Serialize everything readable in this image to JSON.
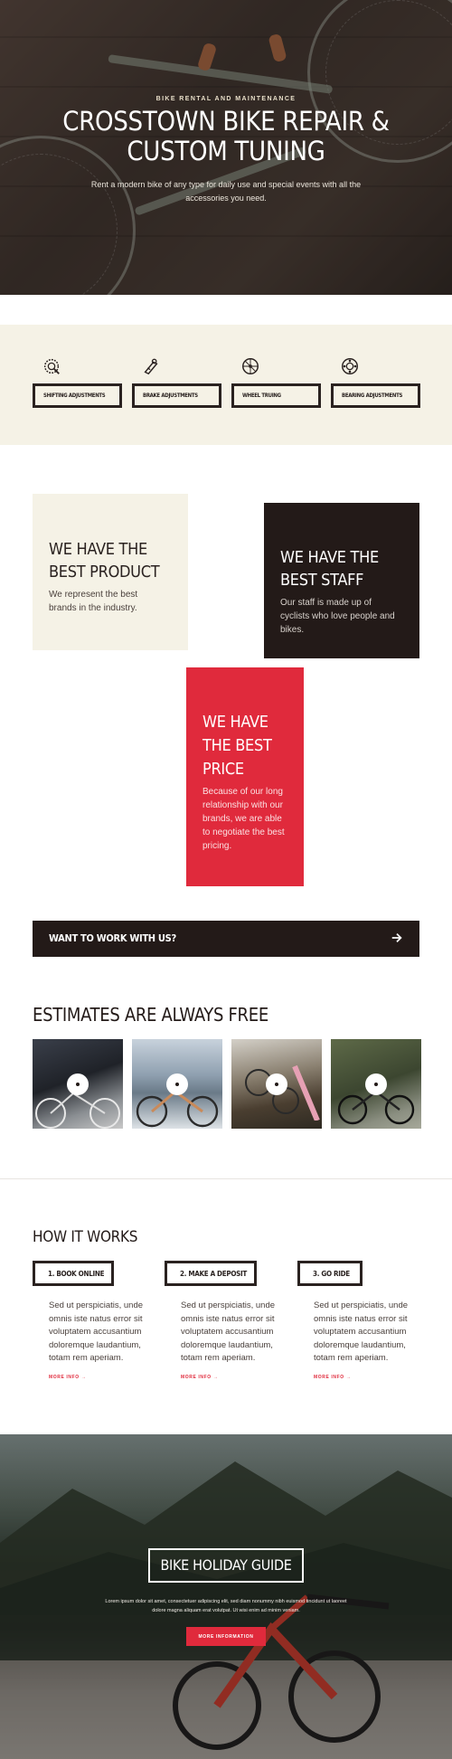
{
  "hero": {
    "kicker": "BIKE RENTAL AND MAINTENANCE",
    "title": "CROSSTOWN BIKE REPAIR & CUSTOM TUNING",
    "subtitle": "Rent a modern bike of any type for daily use and special events with all the accessories you need."
  },
  "services": [
    {
      "icon": "gear-shift-icon",
      "label": "SHIFTING ADJUSTMENTS"
    },
    {
      "icon": "brake-icon",
      "label": "BRAKE ADJUSTMENTS"
    },
    {
      "icon": "wheel-icon",
      "label": "WHEEL TRUING"
    },
    {
      "icon": "bearing-icon",
      "label": "BEARING ADJUSTMENTS"
    }
  ],
  "cards": {
    "product": {
      "title": "WE HAVE THE BEST PRODUCT",
      "text": "We represent the best brands in the industry."
    },
    "staff": {
      "title": "WE HAVE THE BEST STAFF",
      "text": "Our staff is made up of cyclists who love people and bikes."
    },
    "price": {
      "title": "WE HAVE THE BEST PRICE",
      "text": "Because of our long relationship with our brands, we are able to negotiate the best pricing."
    }
  },
  "cta": {
    "label": "WANT TO WORK WITH US?",
    "icon": "arrow-right-icon"
  },
  "estimates": {
    "title": "ESTIMATES ARE ALWAYS FREE",
    "videos": [
      "play-icon",
      "play-icon",
      "play-icon",
      "play-icon"
    ]
  },
  "how": {
    "title": "HOW IT WORKS",
    "steps": [
      {
        "label": "1. BOOK ONLINE",
        "text": "Sed ut perspiciatis, unde omnis iste natus error sit voluptatem accusantium doloremque laudantium, totam rem aperiam.",
        "more": "MORE INFO →"
      },
      {
        "label": "2. MAKE A DEPOSIT",
        "text": "Sed ut perspiciatis, unde omnis iste natus error sit voluptatem accusantium doloremque laudantium, totam rem aperiam.",
        "more": "MORE INFO →"
      },
      {
        "label": "3. GO RIDE",
        "text": "Sed ut perspiciatis, unde omnis iste natus error sit voluptatem accusantium doloremque laudantium, totam rem aperiam.",
        "more": "MORE INFO →"
      }
    ]
  },
  "banner": {
    "title": "BIKE HOLIDAY GUIDE",
    "text": "Lorem ipsum dolor sit amet, consectetuer adipiscing elit, sed diam nonummy nibh euismod tincidunt ut laoreet dolore magna aliquam erat volutpat. Ut wisi enim ad minim veniam.",
    "button": "MORE INFORMATION"
  },
  "colors": {
    "accent": "#e02a3c",
    "dark": "#231a18",
    "cream": "#f5f2e6"
  }
}
